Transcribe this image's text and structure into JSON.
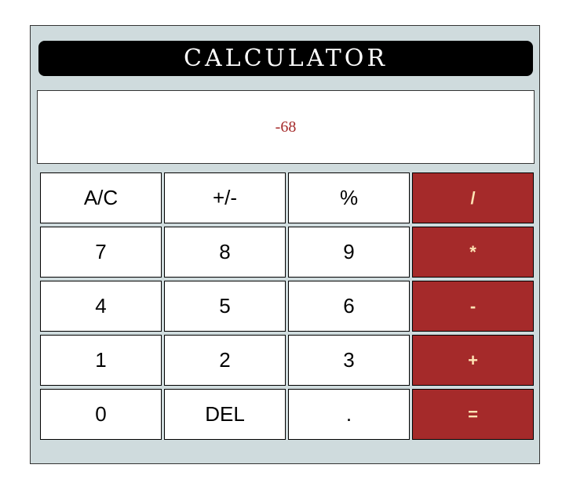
{
  "calculator": {
    "title": "CALCULATOR",
    "display_value": "-68",
    "colors": {
      "panel": "#cfdbdd",
      "title_bg": "#000000",
      "operator_bg": "#a52a2a",
      "operator_text": "#ffe4b5",
      "display_text": "#a52a2a"
    },
    "keys": {
      "clear": "A/C",
      "negate": "+/-",
      "percent": "%",
      "divide": "/",
      "seven": "7",
      "eight": "8",
      "nine": "9",
      "multiply": "*",
      "four": "4",
      "five": "5",
      "six": "6",
      "subtract": "-",
      "one": "1",
      "two": "2",
      "three": "3",
      "add": "+",
      "zero": "0",
      "delete": "DEL",
      "decimal": ".",
      "equals": "="
    }
  }
}
